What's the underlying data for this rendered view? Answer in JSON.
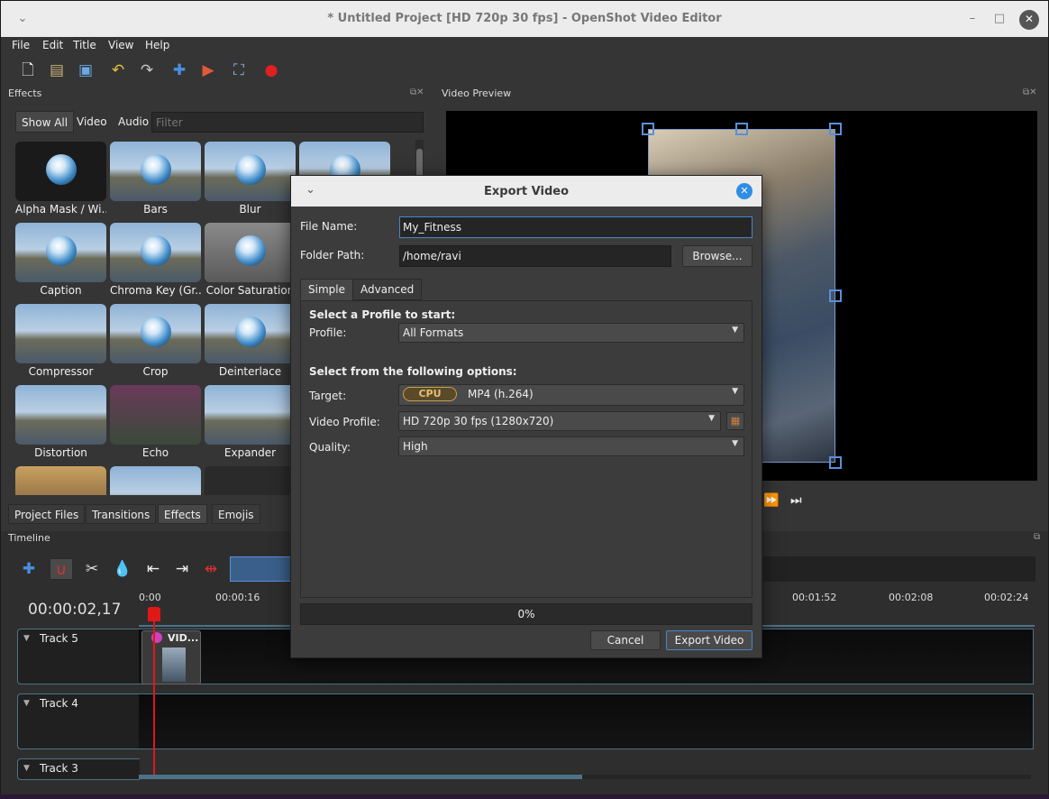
{
  "window": {
    "title": "* Untitled Project [HD 720p 30 fps] - OpenShot Video Editor"
  },
  "menu": [
    "File",
    "Edit",
    "Title",
    "View",
    "Help"
  ],
  "effects_panel": {
    "title": "Effects",
    "filters": [
      "Show All",
      "Video",
      "Audio"
    ],
    "search_placeholder": "Filter",
    "items": [
      "Alpha Mask / Wi...",
      "Bars",
      "Blur",
      "",
      "Caption",
      "Chroma Key (Gr...",
      "Color Saturation",
      "Compressor",
      "Crop",
      "Deinterlace",
      "Distortion",
      "Echo",
      "Expander"
    ]
  },
  "bottom_tabs": [
    "Project Files",
    "Transitions",
    "Effects",
    "Emojis"
  ],
  "preview": {
    "title": "Video Preview"
  },
  "timeline": {
    "title": "Timeline",
    "timecode": "00:00:02,17",
    "ruler": [
      "0:00",
      "00:00:16",
      "00:01:52",
      "00:02:08",
      "00:02:24"
    ],
    "tracks": [
      "Track 5",
      "Track 4",
      "Track 3"
    ],
    "clip_label": "VID..."
  },
  "export_dialog": {
    "title": "Export Video",
    "file_name_label": "File Name:",
    "file_name": "My_Fitness",
    "folder_label": "Folder Path:",
    "folder": "/home/ravi",
    "browse": "Browse...",
    "tabs": [
      "Simple",
      "Advanced"
    ],
    "profile_heading": "Select a Profile to start:",
    "profile_label": "Profile:",
    "profile_value": "All Formats",
    "options_heading": "Select from the following options:",
    "target_label": "Target:",
    "target_badge": "CPU",
    "target_value": "MP4 (h.264)",
    "video_profile_label": "Video Profile:",
    "video_profile_value": "HD 720p 30 fps (1280x720)",
    "quality_label": "Quality:",
    "quality_value": "High",
    "progress_text": "0%",
    "progress": 0,
    "cancel": "Cancel",
    "export": "Export Video"
  }
}
